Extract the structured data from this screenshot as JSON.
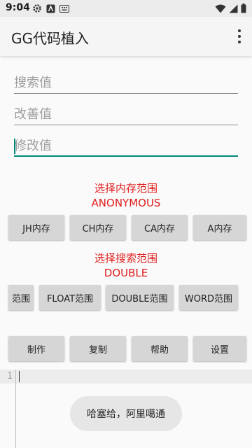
{
  "status_bar": {
    "time": "9:04"
  },
  "app_bar": {
    "title": "GG代码植入"
  },
  "fields": {
    "search_placeholder": "搜索值",
    "improve_placeholder": "改善值",
    "modify_placeholder": "修改值"
  },
  "memory_section": {
    "title": "选择内存范围",
    "selected": "ANONYMOUS",
    "buttons": [
      "JH内存",
      "CH内存",
      "CA内存",
      "A内存"
    ]
  },
  "search_section": {
    "title": "选择搜索范围",
    "selected": "DOUBLE",
    "buttons": [
      "范围",
      "FLOAT范围",
      "DOUBLE范围",
      "WORD范围"
    ]
  },
  "actions": [
    "制作",
    "复制",
    "帮助",
    "设置"
  ],
  "editor": {
    "line_number": "1"
  },
  "toast": "哈塞给，阿里噶通"
}
